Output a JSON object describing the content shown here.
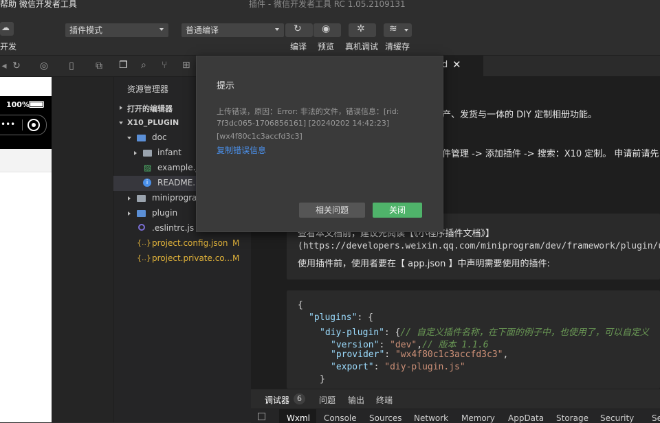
{
  "menubar": {
    "menu_text": "帮助  微信开发者工具",
    "window_title": "插件 - 微信开发者工具 RC 1.05.2109131"
  },
  "toolbar": {
    "partial_label": "开发",
    "mode_select": "插件模式",
    "compile_select": "普通编译",
    "compile_label": "编译",
    "preview_label": "预览",
    "realdevice_label": "真机调试",
    "clearcache_label": "清缓存"
  },
  "simulator": {
    "battery_text": "100%"
  },
  "explorer": {
    "title": "资源管理器",
    "open_editors": "打开的编辑器",
    "root": "X10_PLUGIN",
    "items": [
      {
        "name": "doc"
      },
      {
        "name": "infant"
      },
      {
        "name": "example.j"
      },
      {
        "name": "README.r"
      },
      {
        "name": "miniprogra"
      },
      {
        "name": "plugin"
      },
      {
        "name": ".eslintrc.js"
      },
      {
        "name": "project.config.json",
        "badge": "M"
      },
      {
        "name": "project.private.co...",
        "badge": "M"
      }
    ]
  },
  "editor": {
    "tab_partial": "d",
    "line1": "产、发货与一体的 DIY 定制相册功能。",
    "line2": "件管理 -> 添加插件 -> 搜索：X10 定制。 申请前请先",
    "block1_line0": "查看本文档前，建议先阅读【《小程序插件文档》】",
    "block1_line1": "(https://developers.weixin.qq.com/miniprogram/dev/framework/plugin/us",
    "block1_line2": "使用插件前，使用者要在【 app.json 】中声明需要使用的插件:",
    "code": {
      "l1": "{",
      "l2_key": "\"plugins\"",
      "l2_rest": ": {",
      "l3_key": "\"diy-plugin\"",
      "l3_rest": ": {",
      "l3_comment": "// 自定义插件名称，在下面的例子中，也使用了，可以自定义",
      "l4_key": "\"version\"",
      "l4_val": "\"dev\"",
      "l4_comment": "// 版本 1.1.6",
      "l5_key": "\"provider\"",
      "l5_val": "\"wx4f80c1c3accfd3c3\"",
      "l6_key": "\"export\"",
      "l6_val": "\"diy-plugin.js\"",
      "l7": "}"
    }
  },
  "debugger": {
    "tabs": [
      "调试器",
      "问题",
      "输出",
      "终端"
    ],
    "count": "6",
    "devtools_tabs": [
      "Wxml",
      "Console",
      "Sources",
      "Network",
      "Memory",
      "AppData",
      "Storage",
      "Security",
      "Se"
    ]
  },
  "dialog": {
    "title": "提示",
    "message_line1": "上传错误，原因：Error: 非法的文件，错误信息：[rid:",
    "message_line2": "7f3dc065-1706856161] [20240202 14:42:23]",
    "message_line3": "[wx4f80c1c3accfd3c3]",
    "copy_link": "复制错误信息",
    "related_button": "相关问题",
    "close_button": "关闭"
  },
  "colors": {
    "accent_green": "#4fb36a",
    "link_blue": "#4a8fe8",
    "comment_green": "#6a9955",
    "key_blue": "#9cdcfe",
    "string_orange": "#ce9178"
  }
}
